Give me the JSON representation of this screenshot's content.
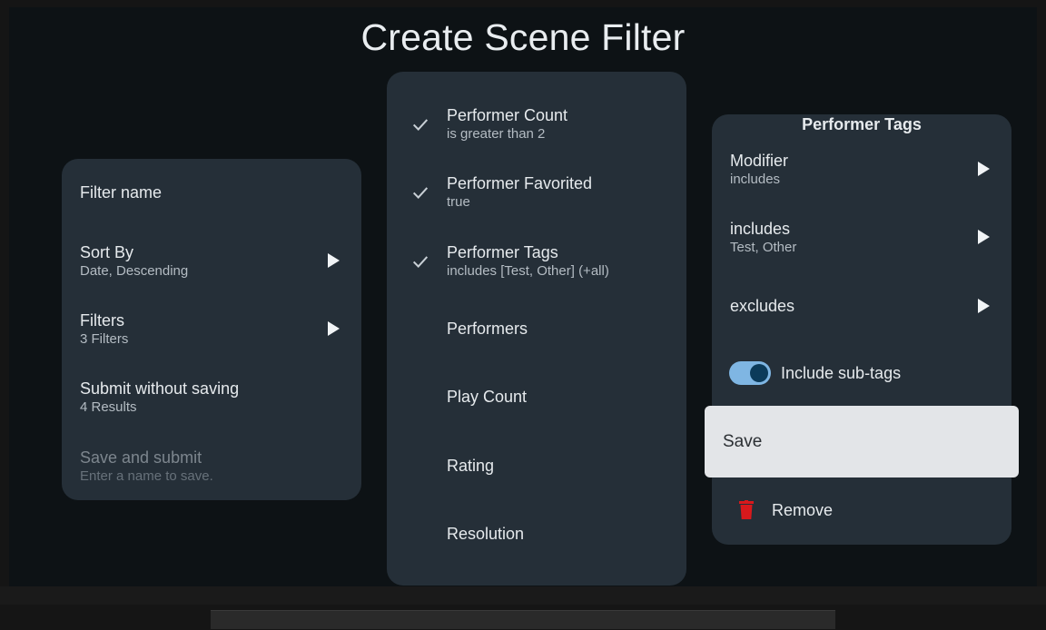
{
  "title": "Create Scene Filter",
  "left_panel": {
    "items": [
      {
        "label": "Filter name",
        "sub": ""
      },
      {
        "label": "Sort By",
        "sub": "Date, Descending"
      },
      {
        "label": "Filters",
        "sub": "3 Filters"
      },
      {
        "label": "Submit without saving",
        "sub": "4 Results"
      },
      {
        "label": "Save and submit",
        "sub": "Enter a name to save."
      }
    ]
  },
  "mid_panel": {
    "items": [
      {
        "label": "Performer Count",
        "sub": "is greater than 2",
        "checked": true
      },
      {
        "label": "Performer Favorited",
        "sub": "true",
        "checked": true
      },
      {
        "label": "Performer Tags",
        "sub": "includes [Test, Other] (+all)",
        "checked": true
      },
      {
        "label": "Performers",
        "sub": "",
        "checked": false
      },
      {
        "label": "Play Count",
        "sub": "",
        "checked": false
      },
      {
        "label": "Rating",
        "sub": "",
        "checked": false
      },
      {
        "label": "Resolution",
        "sub": "",
        "checked": false
      }
    ]
  },
  "right_panel": {
    "title": "Performer Tags",
    "modifier": {
      "label": "Modifier",
      "sub": "includes"
    },
    "includes": {
      "label": "includes",
      "sub": "Test, Other"
    },
    "excludes": {
      "label": "excludes"
    },
    "toggle": {
      "label": "Include sub-tags",
      "on": true
    },
    "save_label": "Save",
    "remove_label": "Remove"
  },
  "colors": {
    "panel": "#252f38",
    "toggle_track": "#7fb6e3",
    "toggle_knob": "#0c3b5a",
    "trash": "#d8191c"
  }
}
